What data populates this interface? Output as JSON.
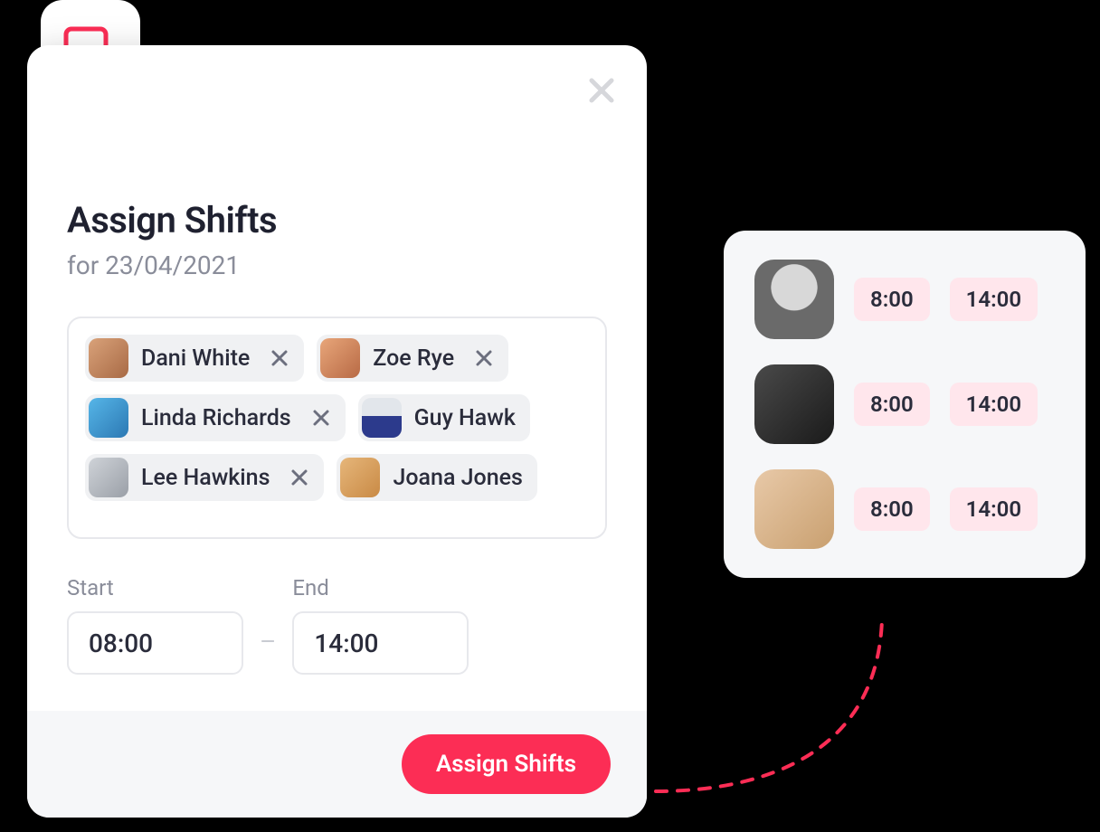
{
  "dialog": {
    "title": "Assign Shifts",
    "subtitle": "for 23/04/2021",
    "people": [
      {
        "name": "Dani White",
        "removable": true
      },
      {
        "name": "Zoe Rye",
        "removable": true
      },
      {
        "name": "Linda Richards",
        "removable": true
      },
      {
        "name": "Guy Hawk",
        "removable": false
      },
      {
        "name": "Lee Hawkins",
        "removable": true
      },
      {
        "name": "Joana Jones",
        "removable": false
      }
    ],
    "start_label": "Start",
    "end_label": "End",
    "start_value": "08:00",
    "end_value": "14:00",
    "submit_label": "Assign Shifts"
  },
  "side_card": {
    "rows": [
      {
        "start": "8:00",
        "end": "14:00"
      },
      {
        "start": "8:00",
        "end": "14:00"
      },
      {
        "start": "8:00",
        "end": "14:00"
      }
    ]
  },
  "colors": {
    "accent": "#fc2d55"
  }
}
